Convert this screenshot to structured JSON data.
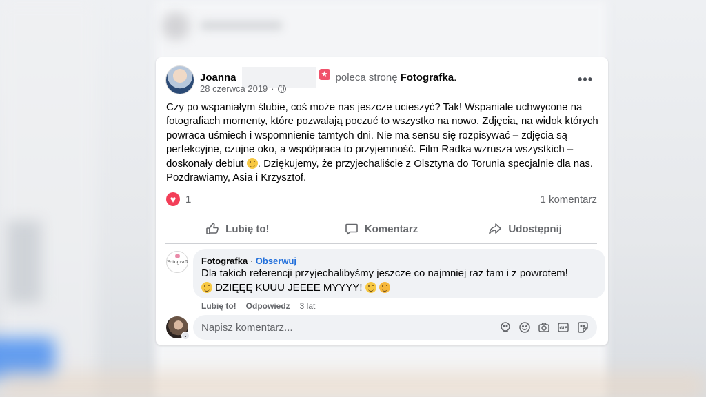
{
  "post": {
    "author_first": "Joanna",
    "verb": "poleca stronę",
    "page": "Fotografka",
    "period": ".",
    "date": "28 czerwca 2019",
    "separator": "·",
    "more": "•••",
    "text_part1": "Czy po wspaniałym ślubie, coś może nas jeszcze ucieszyć? Tak! Wspaniale uchwycone na fotografiach momenty, które pozwalają poczuć to wszystko na nowo. Zdjęcia, na widok których powraca uśmiech i wspomnienie tamtych dni. Nie ma sensu się rozpisywać – zdjęcia są perfekcyjne, czujne oko, a współpraca to przyjemność. Film Radka wzrusza wszystkich – doskonały debiut",
    "text_part2": ". Dziękujemy, że przyjechaliście z Olsztyna do Torunia specjalnie dla nas. Pozdrawiamy, Asia i Krzysztof.",
    "reaction_count": "1",
    "comment_count": "1 komentarz"
  },
  "actions": {
    "like": "Lubię to!",
    "comment": "Komentarz",
    "share": "Udostępnij"
  },
  "comment": {
    "author": "Fotografka",
    "dot": "·",
    "follow": "Obserwuj",
    "avatar_text": "Fotografka",
    "line1": "Dla takich referencji przyjechalibyśmy jeszcze co najmniej raz tam i z powrotem!",
    "line2": "DZIĘĘĘ KUUU JEEEE MYYYY!",
    "like": "Lubię to!",
    "reply": "Odpowiedz",
    "age": "3 lat"
  },
  "compose": {
    "placeholder": "Napisz komentarz..."
  },
  "icons": {
    "recommend": "recommend-icon",
    "privacy": "globe-icon",
    "heart": "heart-reaction-icon",
    "like": "thumbs-up-icon",
    "comment": "speech-bubble-icon",
    "share": "share-arrow-icon",
    "sticker": "sticker-icon",
    "emoji": "emoji-icon",
    "camera": "camera-icon",
    "gif": "gif-icon",
    "avatar_sticker": "avatar-sticker-icon"
  },
  "colors": {
    "accent_blue": "#216fdb",
    "heart_red": "#f33e58",
    "recommend_red": "#f0526b",
    "secondary_text": "#65676b",
    "bubble_bg": "#f0f2f5"
  }
}
